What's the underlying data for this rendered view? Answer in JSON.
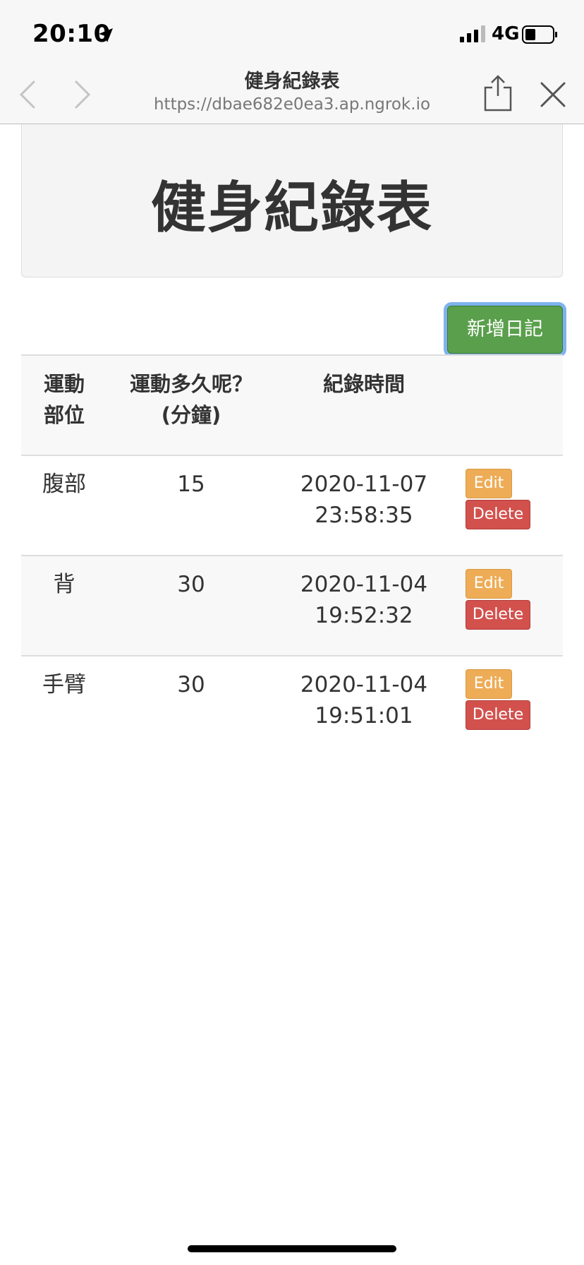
{
  "status_bar": {
    "time": "20:10",
    "network": "4G"
  },
  "browser": {
    "page_title": "健身紀錄表",
    "url": "https://dbae682e0ea3.ap.ngrok.io"
  },
  "page": {
    "heading": "健身紀錄表",
    "add_button_label": "新增日記",
    "table": {
      "headers": {
        "part_line1": "運動",
        "part_line2": "部位",
        "duration_line1": "運動多久呢？",
        "duration_line2": "(分鐘)",
        "time": "紀錄時間"
      },
      "rows": [
        {
          "part": "腹部",
          "duration": "15",
          "date": "2020-11-07",
          "clock": "23:58:35",
          "edit_label": "Edit",
          "delete_label": "Delete"
        },
        {
          "part": "背",
          "duration": "30",
          "date": "2020-11-04",
          "clock": "19:52:32",
          "edit_label": "Edit",
          "delete_label": "Delete"
        },
        {
          "part": "手臂",
          "duration": "30",
          "date": "2020-11-04",
          "clock": "19:51:01",
          "edit_label": "Edit",
          "delete_label": "Delete"
        }
      ]
    }
  },
  "colors": {
    "add_button": "#5a9f4c",
    "edit_button": "#eeac57",
    "delete_button": "#d2514d",
    "focus_ring": "#7fb3ee"
  }
}
